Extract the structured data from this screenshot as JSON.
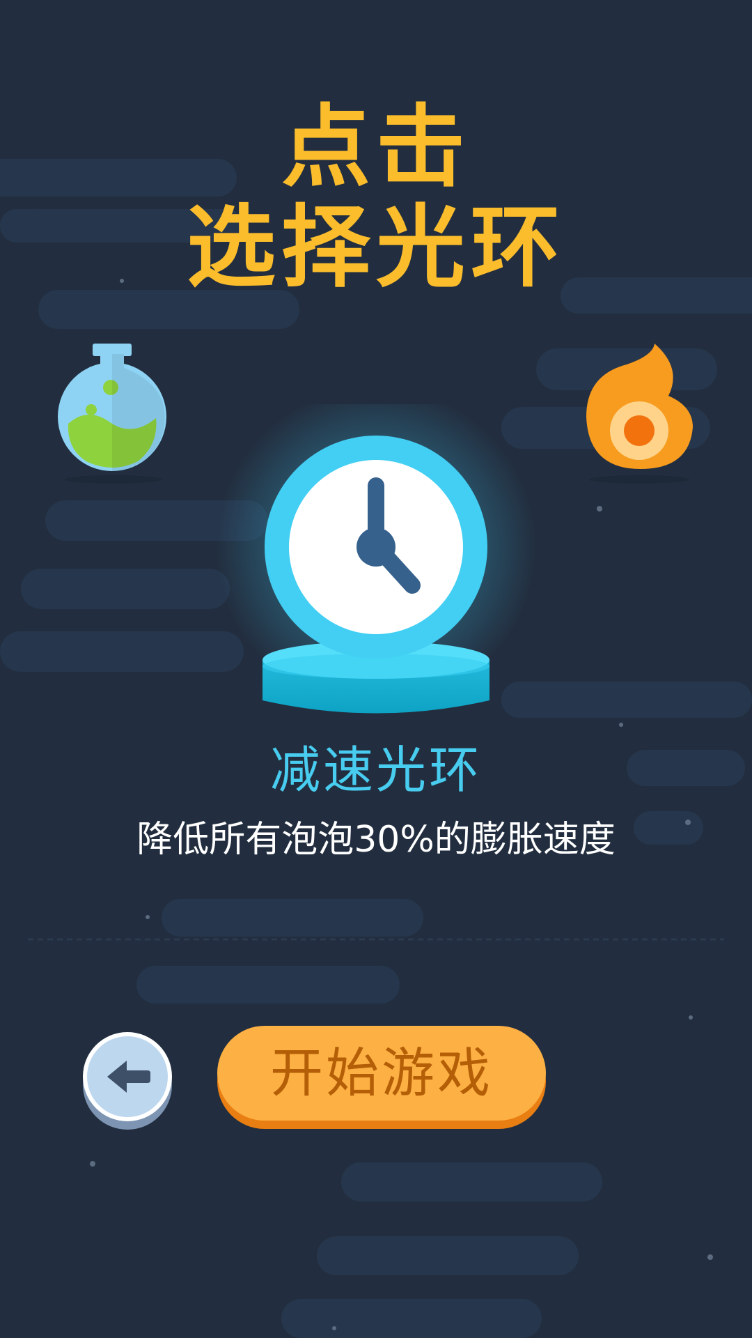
{
  "title": {
    "line1": "点击",
    "line2": "选择光环"
  },
  "aura": {
    "icon": "clock-icon",
    "name": "减速光环",
    "description": "降低所有泡泡30%的膨胀速度"
  },
  "side_auras": [
    {
      "icon": "potion-icon"
    },
    {
      "icon": "fire-icon"
    }
  ],
  "buttons": {
    "back_icon": "back-arrow-icon",
    "start_label": "开始游戏"
  },
  "colors": {
    "background": "#222e3f",
    "title": "#fbbd2c",
    "aura_name": "#48cdf1",
    "description": "#ffffff",
    "start_button": "#fdb043",
    "start_button_text": "#b45f07"
  }
}
